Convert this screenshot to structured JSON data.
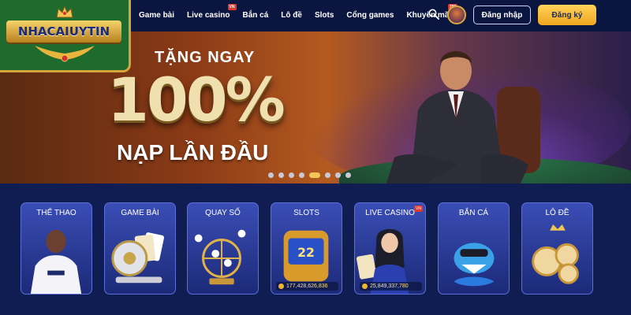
{
  "logo": {
    "text": "NHACAIUYTIN"
  },
  "nav": {
    "items": [
      {
        "label": "Game bài",
        "badge": ""
      },
      {
        "label": "Live casino",
        "badge": "VN"
      },
      {
        "label": "Bắn cá",
        "badge": ""
      },
      {
        "label": "Lô đề",
        "badge": ""
      },
      {
        "label": "Slots",
        "badge": ""
      },
      {
        "label": "Cổng games",
        "badge": ""
      },
      {
        "label": "Khuyến mãi",
        "badge": "789"
      }
    ],
    "login_label": "Đăng nhập",
    "register_label": "Đăng ký"
  },
  "banner": {
    "line1": "TẶNG NGAY",
    "line2": "100%",
    "line3": "NẠP LẦN ĐẦU",
    "slide_count": 9,
    "active_slide": 5
  },
  "cards": [
    {
      "title": "THỂ THAO",
      "counter": "",
      "badge": ""
    },
    {
      "title": "GAME BÀI",
      "counter": "",
      "badge": ""
    },
    {
      "title": "QUAY SỐ",
      "counter": "",
      "badge": ""
    },
    {
      "title": "SLOTS",
      "counter": "177,428,626,836",
      "badge": ""
    },
    {
      "title": "LIVE CASINO",
      "counter": "25,849,337,780",
      "badge": "VN"
    },
    {
      "title": "BẮN CÁ",
      "counter": "",
      "badge": ""
    },
    {
      "title": "LÔ ĐỀ",
      "counter": "",
      "badge": ""
    }
  ],
  "colors": {
    "header_bg": "#0b1640",
    "accent_gold": "#f0c65a",
    "card_bg": "#2a3a9a",
    "logo_green": "#1f6b2e"
  }
}
